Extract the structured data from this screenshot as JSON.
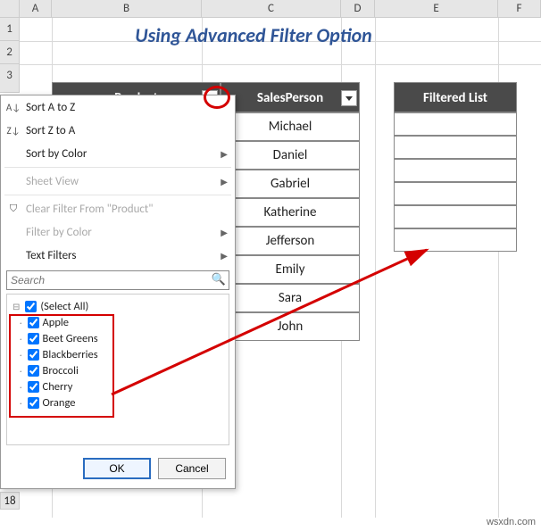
{
  "columns": [
    "A",
    "B",
    "C",
    "D",
    "E",
    "F"
  ],
  "rows": [
    "1",
    "2",
    "3"
  ],
  "title": "Using Advanced Filter Option",
  "headers": {
    "product": "Product",
    "sales": "SalesPerson",
    "filtered": "Filtered List"
  },
  "salespersons": [
    "Michael",
    "Daniel",
    "Gabriel",
    "Katherine",
    "Jefferson",
    "Emily",
    "Sara",
    "John"
  ],
  "filter_menu": {
    "sort_az": "Sort A to Z",
    "sort_za": "Sort Z to A",
    "sort_color": "Sort by Color",
    "sheet_view": "Sheet View",
    "clear": "Clear Filter From \"Product\"",
    "filter_color": "Filter by Color",
    "text_filters": "Text Filters",
    "search_placeholder": "Search",
    "select_all": "(Select All)",
    "items": [
      "Apple",
      "Beet Greens",
      "Blackberries",
      "Broccoli",
      "Cherry",
      "Orange"
    ],
    "ok": "OK",
    "cancel": "Cancel"
  },
  "row18": "18",
  "watermark": "wsxdn.com"
}
